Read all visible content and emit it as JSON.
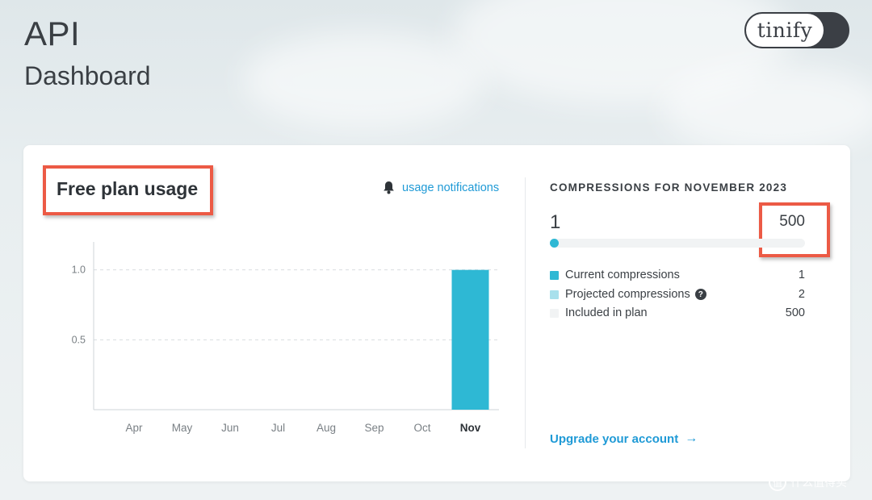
{
  "header": {
    "title": "API",
    "subtitle": "Dashboard"
  },
  "logo": {
    "text": "tinify"
  },
  "usage": {
    "title": "Free plan usage",
    "notifications_label": "usage notifications"
  },
  "chart_data": {
    "type": "bar",
    "categories": [
      "Apr",
      "May",
      "Jun",
      "Jul",
      "Aug",
      "Sep",
      "Oct",
      "Nov"
    ],
    "values": [
      0,
      0,
      0,
      0,
      0,
      0,
      0,
      1
    ],
    "highlighted_category": "Nov",
    "yticks": [
      "1.0",
      "0.5"
    ],
    "ytick_values": [
      1.0,
      0.5
    ],
    "ylim": [
      0,
      1.2
    ],
    "grid": "dashed-horizontal",
    "bar_color": "#2eb8d4"
  },
  "compressions": {
    "heading": "COMPRESSIONS FOR NOVEMBER 2023",
    "current": "1",
    "limit": "500",
    "progress_fraction": 0.002,
    "legend": [
      {
        "label": "Current compressions",
        "value": "1",
        "color": "#2eb8d4",
        "help": false
      },
      {
        "label": "Projected compressions",
        "value": "2",
        "color": "#a8e0ec",
        "help": true
      },
      {
        "label": "Included in plan",
        "value": "500",
        "color": "#f1f3f4",
        "help": false
      }
    ],
    "upgrade_label": "Upgrade your account",
    "upgrade_arrow": "→"
  },
  "watermark": {
    "badge": "值",
    "text": "什么值得买"
  },
  "colors": {
    "accent": "#2eb8d4",
    "link": "#1f9ad6",
    "annotation": "#ec5a45"
  }
}
